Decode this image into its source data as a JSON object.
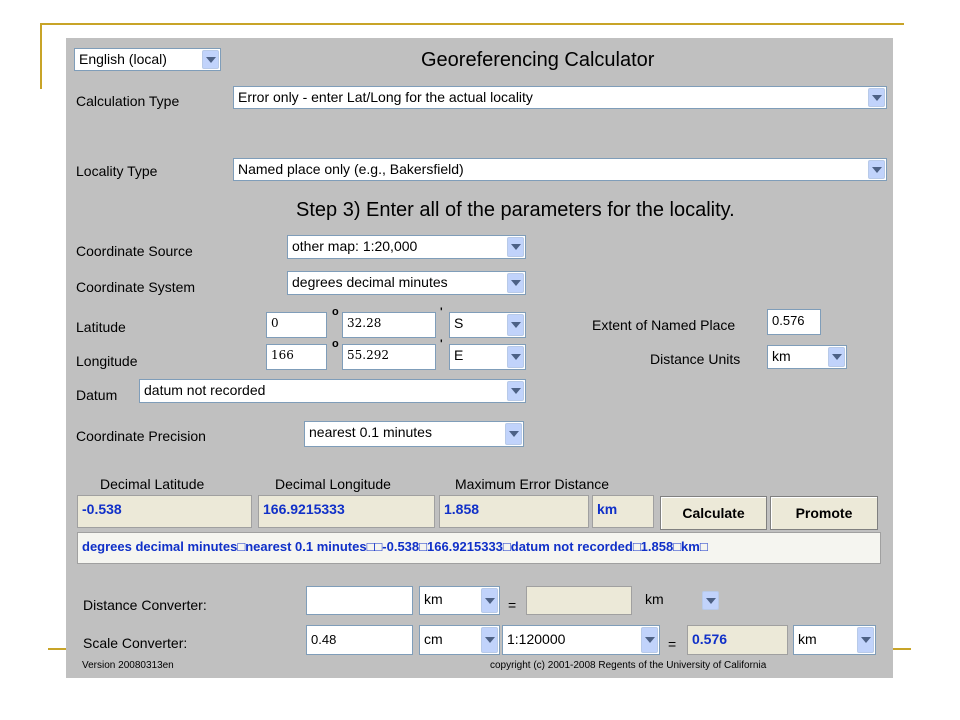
{
  "language_select": "English (local)",
  "title": "Georeferencing Calculator",
  "calculation_type": {
    "label": "Calculation Type",
    "value": "Error only - enter Lat/Long for the actual locality"
  },
  "locality_type": {
    "label": "Locality Type",
    "value": "Named place only (e.g., Bakersfield)"
  },
  "step_heading": "Step 3) Enter all of the parameters for the locality.",
  "coordinate_source": {
    "label": "Coordinate Source",
    "value": "other map: 1:20,000"
  },
  "coordinate_system": {
    "label": "Coordinate System",
    "value": "degrees decimal minutes"
  },
  "latitude": {
    "label": "Latitude",
    "degrees": "0",
    "minutes": "32.28",
    "direction": "S"
  },
  "longitude": {
    "label": "Longitude",
    "degrees": "166",
    "minutes": "55.292",
    "direction": "E"
  },
  "degree_symbol": "o",
  "minute_symbol": "'",
  "extent": {
    "label": "Extent of Named Place",
    "value": "0.576"
  },
  "distance_units": {
    "label": "Distance Units",
    "value": "km"
  },
  "datum": {
    "label": "Datum",
    "value": "datum not recorded"
  },
  "coordinate_precision": {
    "label": "Coordinate Precision",
    "value": "nearest 0.1 minutes"
  },
  "results": {
    "decimal_latitude_label": "Decimal Latitude",
    "decimal_longitude_label": "Decimal Longitude",
    "max_error_label": "Maximum Error Distance",
    "decimal_latitude": "-0.538",
    "decimal_longitude": "166.9215333",
    "max_error": "1.858",
    "max_error_units": "km"
  },
  "buttons": {
    "calculate": "Calculate",
    "promote": "Promote"
  },
  "summary": "degrees decimal minutes□nearest 0.1 minutes□□-0.538□166.9215333□datum not recorded□1.858□km□",
  "distance_converter": {
    "label": "Distance Converter:",
    "input": "",
    "from_unit": "km",
    "equals": "=",
    "result": "",
    "to_unit": "km"
  },
  "scale_converter": {
    "label": "Scale Converter:",
    "input": "0.48",
    "from_unit": "cm",
    "scale": "1:120000",
    "equals": "=",
    "result": "0.576",
    "to_unit": "km"
  },
  "version": "Version 20080313en",
  "copyright": "copyright (c) 2001-2008 Regents of the University of California",
  "colors": {
    "panel": "#c0c0c0",
    "readonly_bg": "#ece9d8",
    "result_text": "#1030c8",
    "slide_accent": "#c8a428"
  }
}
